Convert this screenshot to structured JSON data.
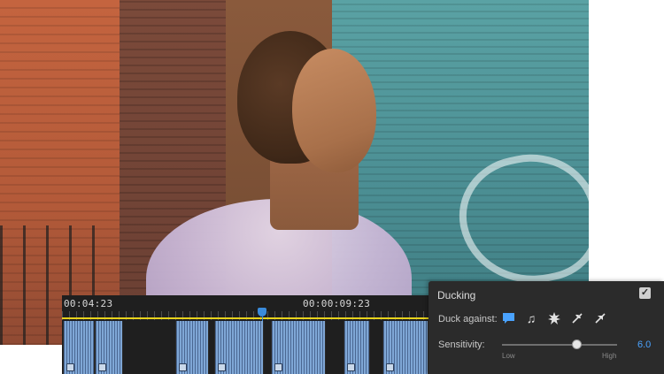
{
  "timeline": {
    "timecodes": [
      "00:04:23",
      "00:00:09:23"
    ],
    "playhead": 0.55
  },
  "ducking": {
    "title": "Ducking",
    "enabled": true,
    "duck_against_label": "Duck against:",
    "duck_icons": [
      "dialogue-icon",
      "music-icon",
      "sfx-icon",
      "ambience-icon",
      "unclassified-icon"
    ],
    "sensitivity_label": "Sensitivity:",
    "sensitivity_value": "6.0",
    "sensitivity_min_label": "Low",
    "sensitivity_max_label": "High",
    "sensitivity_level": 0.65,
    "accent_color": "#4aa3ff"
  }
}
